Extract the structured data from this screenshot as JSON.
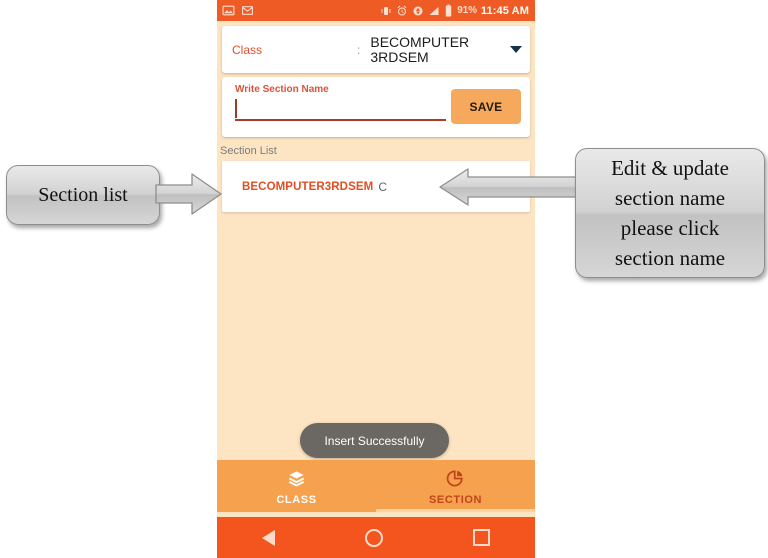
{
  "phone": {
    "status_bar": {
      "icons_left": [
        "image-icon",
        "gmail-icon"
      ],
      "icons_right": [
        "vibrate-icon",
        "alarm-icon",
        "location-icon",
        "signal-icon",
        "battery-icon"
      ],
      "battery_percent": "91%",
      "time": "11:45 AM",
      "background_color": "#ef5b25"
    },
    "class_card": {
      "label": "Class",
      "separator": ":",
      "value": "BECOMPUTER3RDSEM",
      "caret_icon": "chevron-down-icon"
    },
    "input_card": {
      "field_label": "Write Section Name",
      "field_value": "",
      "field_placeholder": "",
      "save_label": "SAVE",
      "save_color": "#f6a95c"
    },
    "section_list": {
      "header": "Section List",
      "rows": [
        {
          "class_name": "BECOMPUTER3RDSEM",
          "section_name": "C"
        }
      ]
    },
    "toast": {
      "message": "Insert Successfully",
      "background_color": "#6b6762"
    },
    "bottom_nav": {
      "background_color": "#f5a14d",
      "tabs": [
        {
          "label": "CLASS",
          "icon": "layers-icon",
          "selected": false
        },
        {
          "label": "SECTION",
          "icon": "pie-chart-icon",
          "selected": true
        }
      ]
    },
    "android_nav": {
      "background_color": "#f4551f",
      "buttons": [
        "back-icon",
        "home-icon",
        "recents-icon"
      ]
    },
    "content_background_color": "#fde4c3"
  },
  "annotations": {
    "left": {
      "text": "Section list",
      "arrow_direction": "right",
      "arrow_icon": "arrow-right-icon"
    },
    "right": {
      "line1": "Edit & update",
      "line2": "section name",
      "line3": "please click",
      "line4": "section name",
      "arrow_direction": "left",
      "arrow_icon": "arrow-left-icon"
    }
  }
}
